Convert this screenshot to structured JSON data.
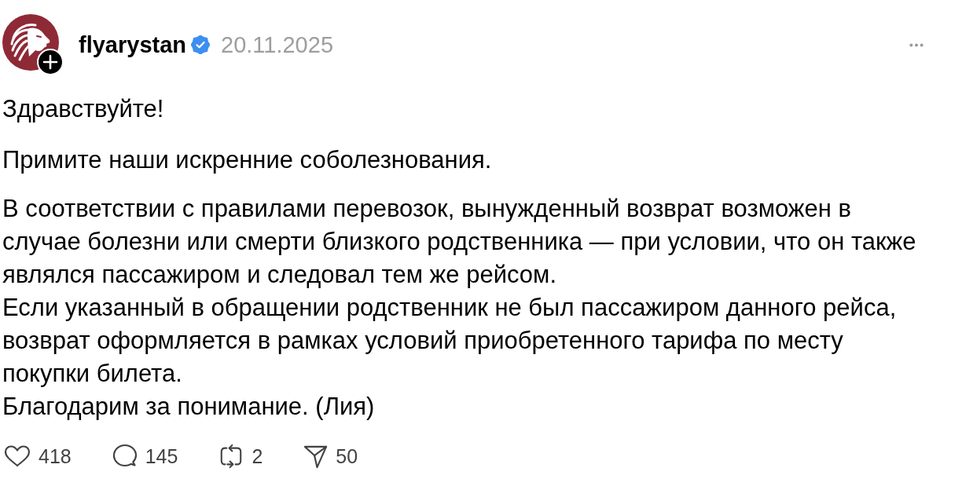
{
  "post": {
    "author": {
      "username": "flyarystan",
      "verified": true
    },
    "date": "20.11.2025",
    "paragraphs": [
      [
        "Здравствуйте!"
      ],
      [
        "Примите наши искренние соболезнования."
      ],
      [
        "В соответствии с правилами перевозок, вынужденный возврат возможен в случае болезни или смерти близкого родственника — при условии, что он также являлся пассажиром и следовал тем же рейсом.",
        "Если указанный в обращении родственник не был пассажиром данного рейса, возврат оформляется в рамках условий приобретенного тарифа по месту покупки билета.",
        "Благодарим за понимание. (Лия)"
      ]
    ]
  },
  "actions": [
    {
      "kind": "like",
      "count": "418"
    },
    {
      "kind": "reply",
      "count": "145"
    },
    {
      "kind": "repost",
      "count": "2"
    },
    {
      "kind": "share",
      "count": "50"
    }
  ]
}
